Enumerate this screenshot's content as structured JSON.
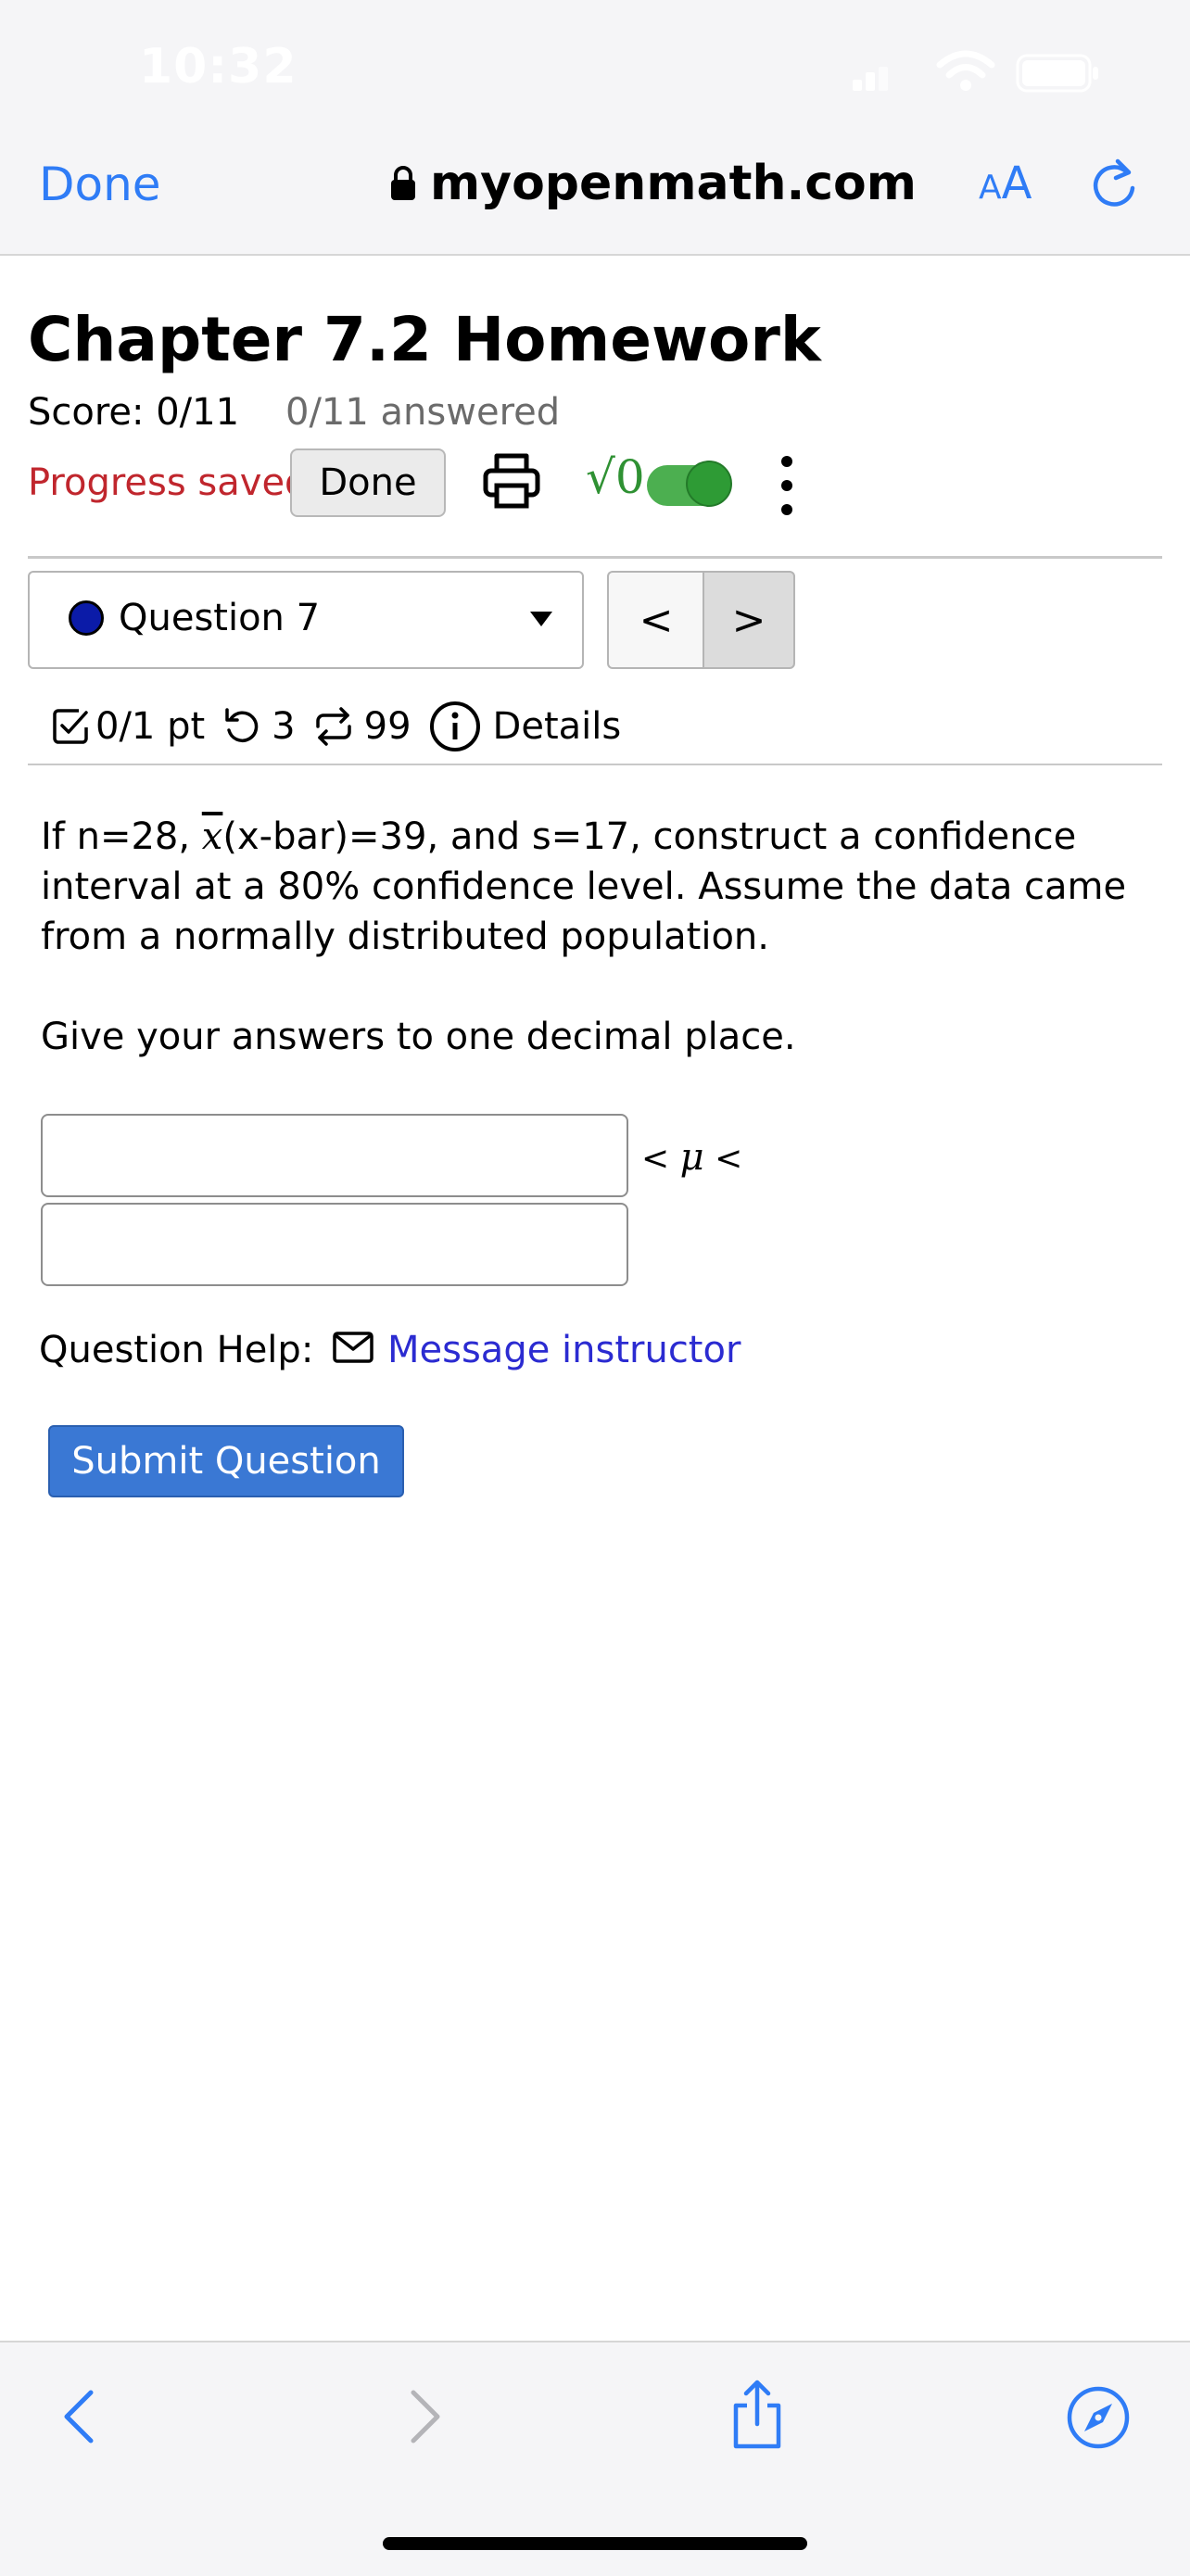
{
  "status_bar": {
    "time": "10:32"
  },
  "browser": {
    "done_label": "Done",
    "url": "myopenmath.com",
    "text_size_small": "A",
    "text_size_large": "A"
  },
  "header": {
    "title": "Chapter 7.2 Homework",
    "score": "Score: 0/11",
    "answered": "0/11 answered",
    "progress_status": "Progress saved",
    "done_button": "Done",
    "math_toggle_label": "√0"
  },
  "question_nav": {
    "selected": "Question 7",
    "prev_label": "<",
    "next_label": ">"
  },
  "question_meta": {
    "points": "0/1 pt",
    "attempts": "3",
    "versions": "99",
    "details_label": "Details"
  },
  "question": {
    "text_part1": "If n=28, ",
    "xbar": "x",
    "text_part2": "(x-bar)=39, and s=17, construct a confidence interval at a 80% confidence level. Assume the data came from a normally distributed population.",
    "instruction": "Give your answers to one decimal place.",
    "inequality_left": "<",
    "mu": "μ",
    "inequality_right": "<",
    "lower_value": "",
    "upper_value": ""
  },
  "help": {
    "label": "Question Help:",
    "message_link": "Message instructor"
  },
  "submit_label": "Submit Question",
  "colors": {
    "ios_blue": "#2f7cf6",
    "progress_red": "#c0262d",
    "link_blue": "#2b2bd1",
    "submit_blue": "#3a78d4",
    "toggle_green": "#4caf50"
  }
}
